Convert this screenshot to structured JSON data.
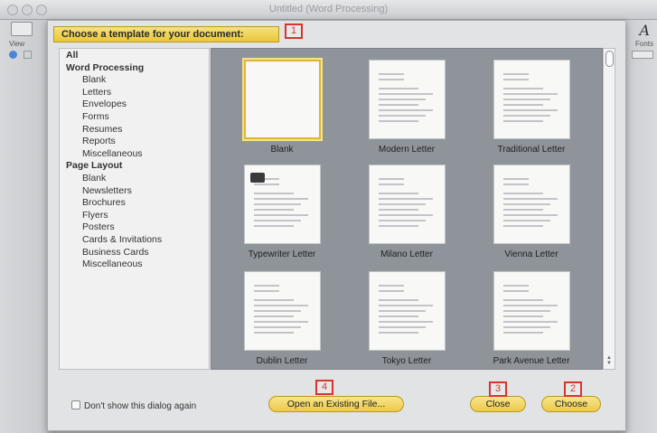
{
  "window": {
    "title": "Untitled (Word Processing)",
    "view_label": "View",
    "fonts_label": "Fonts",
    "fonts_glyph": "A"
  },
  "dialog": {
    "prompt": "Choose a template for your document:",
    "categories": [
      {
        "label": "All",
        "level": "all"
      },
      {
        "label": "Word Processing",
        "level": "head"
      },
      {
        "label": "Blank",
        "level": "sub"
      },
      {
        "label": "Letters",
        "level": "sub"
      },
      {
        "label": "Envelopes",
        "level": "sub"
      },
      {
        "label": "Forms",
        "level": "sub"
      },
      {
        "label": "Resumes",
        "level": "sub"
      },
      {
        "label": "Reports",
        "level": "sub"
      },
      {
        "label": "Miscellaneous",
        "level": "sub"
      },
      {
        "label": "Page Layout",
        "level": "head"
      },
      {
        "label": "Blank",
        "level": "sub"
      },
      {
        "label": "Newsletters",
        "level": "sub"
      },
      {
        "label": "Brochures",
        "level": "sub"
      },
      {
        "label": "Flyers",
        "level": "sub"
      },
      {
        "label": "Posters",
        "level": "sub"
      },
      {
        "label": "Cards & Invitations",
        "level": "sub"
      },
      {
        "label": "Business Cards",
        "level": "sub"
      },
      {
        "label": "Miscellaneous",
        "level": "sub"
      }
    ],
    "templates": [
      {
        "label": "Blank",
        "selected": true
      },
      {
        "label": "Modern Letter",
        "selected": false
      },
      {
        "label": "Traditional Letter",
        "selected": false
      },
      {
        "label": "Typewriter Letter",
        "selected": false
      },
      {
        "label": "Milano Letter",
        "selected": false
      },
      {
        "label": "Vienna Letter",
        "selected": false
      },
      {
        "label": "Dublin Letter",
        "selected": false
      },
      {
        "label": "Tokyo Letter",
        "selected": false
      },
      {
        "label": "Park Avenue Letter",
        "selected": false
      }
    ],
    "dont_show_label": "Don't show this dialog again",
    "dont_show_checked": false,
    "open_existing_label": "Open an Existing File...",
    "close_label": "Close",
    "choose_label": "Choose"
  },
  "annotations": {
    "marker_1": "1",
    "marker_2": "2",
    "marker_3": "3",
    "marker_4": "4",
    "color": "#d9342b"
  },
  "colors": {
    "accent_yellow": "#eec94a",
    "selection_outline": "#e1b437",
    "template_grid_bg": "#8f949b"
  }
}
